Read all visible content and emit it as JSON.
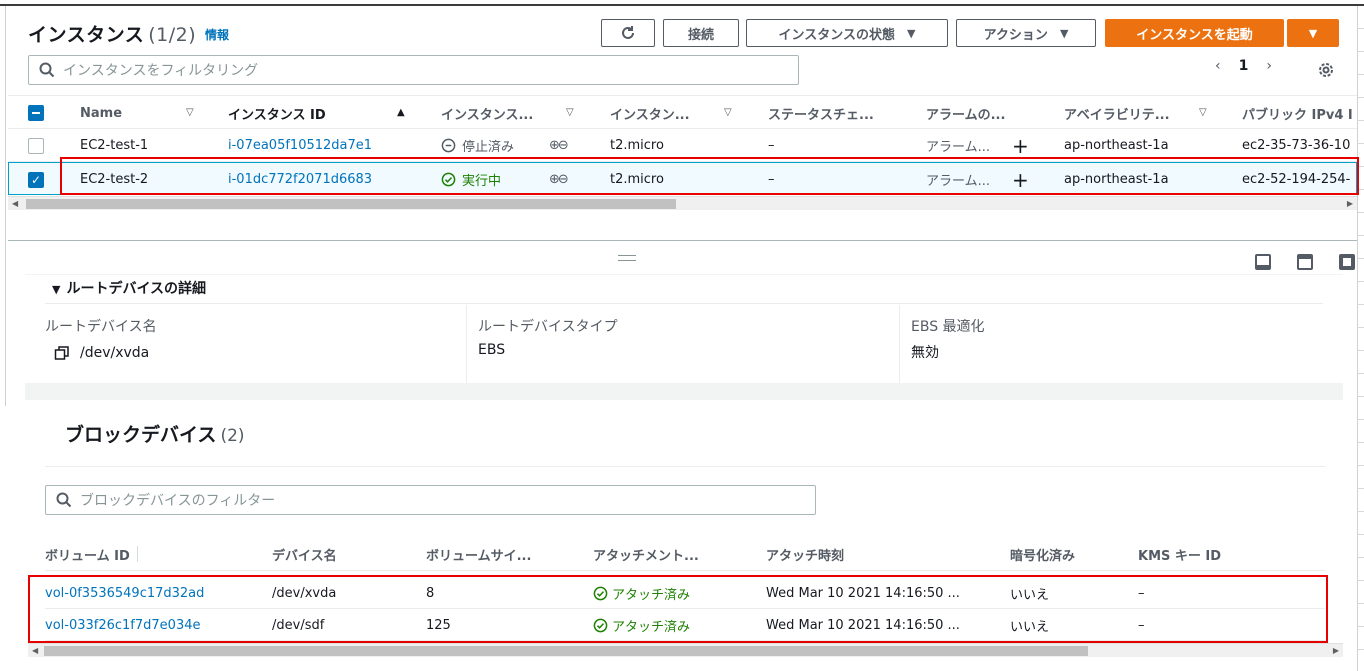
{
  "instances": {
    "title": "インスタンス",
    "count": "(1/2)",
    "info_link": "情報",
    "toolbar": {
      "connect_label": "接続",
      "state_label": "インスタンスの状態",
      "action_label": "アクション",
      "launch_label": "インスタンスを起動"
    },
    "search_placeholder": "インスタンスをフィルタリング",
    "page_number": "1",
    "columns": [
      "Name",
      "インスタンス ID",
      "インスタンス...",
      "インスタン...",
      "ステータスチェ...",
      "アラームの...",
      "アベイラビリテ...",
      "パブリック IPv4 I"
    ],
    "rows": [
      {
        "name": "EC2-test-1",
        "id": "i-07ea05f10512da7e1",
        "state": "停止済み",
        "type": "t2.micro",
        "status": "–",
        "alarm": "アラーム...",
        "az": "ap-northeast-1a",
        "ip": "ec2-35-73-36-10",
        "selected": false
      },
      {
        "name": "EC2-test-2",
        "id": "i-01dc772f2071d6683",
        "state": "実行中",
        "type": "t2.micro",
        "status": "–",
        "alarm": "アラーム...",
        "az": "ap-northeast-1a",
        "ip": "ec2-52-194-254-",
        "selected": true
      }
    ]
  },
  "root_device": {
    "section_title": "ルートデバイスの詳細",
    "name_label": "ルートデバイス名",
    "name_value": "/dev/xvda",
    "type_label": "ルートデバイスタイプ",
    "type_value": "EBS",
    "ebs_label": "EBS 最適化",
    "ebs_value": "無効"
  },
  "block_devices": {
    "title": "ブロックデバイス",
    "count": "(2)",
    "search_placeholder": "ブロックデバイスのフィルター",
    "columns": [
      "ボリューム ID",
      "デバイス名",
      "ボリュームサイ...",
      "アタッチメント...",
      "アタッチ時刻",
      "暗号化済み",
      "KMS キー ID"
    ],
    "rows": [
      {
        "volume_id": "vol-0f3536549c17d32ad",
        "device": "/dev/xvda",
        "size": "8",
        "status": "アタッチ済み",
        "time": "Wed Mar 10 2021 14:16:50 ...",
        "encrypted": "いいえ",
        "kms": "–"
      },
      {
        "volume_id": "vol-033f26c1f7d7e034e",
        "device": "/dev/sdf",
        "size": "125",
        "status": "アタッチ済み",
        "time": "Wed Mar 10 2021 14:16:50 ...",
        "encrypted": "いいえ",
        "kms": "–"
      }
    ]
  },
  "colors": {
    "primary": "#ec7211",
    "link": "#0073bb",
    "success": "#1d8102",
    "highlight": "#e60000"
  }
}
